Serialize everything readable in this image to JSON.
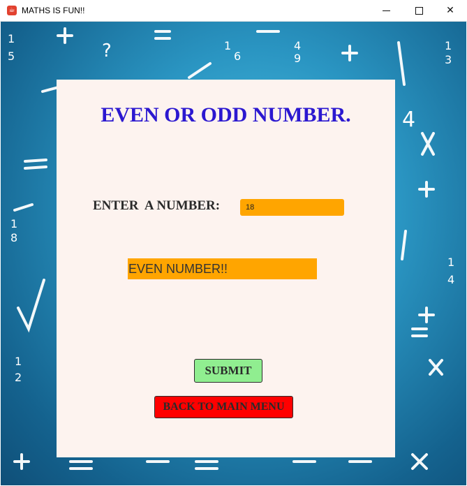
{
  "window": {
    "title": "MATHS IS FUN!!",
    "controls": [
      "minimize",
      "maximize",
      "close"
    ]
  },
  "panel": {
    "heading": "EVEN OR ODD NUMBER.",
    "enter_label": "ENTER  A NUMBER:",
    "number_value": "18",
    "result_text": "EVEN NUMBER!!",
    "submit_label": "SUBMIT",
    "back_label": "BACK TO MAIN MENU"
  },
  "colors": {
    "heading": "#2b18d0",
    "field": "#ffa500",
    "submit": "#90ee90",
    "back": "#ff0000",
    "panel": "#fdf3ef"
  }
}
